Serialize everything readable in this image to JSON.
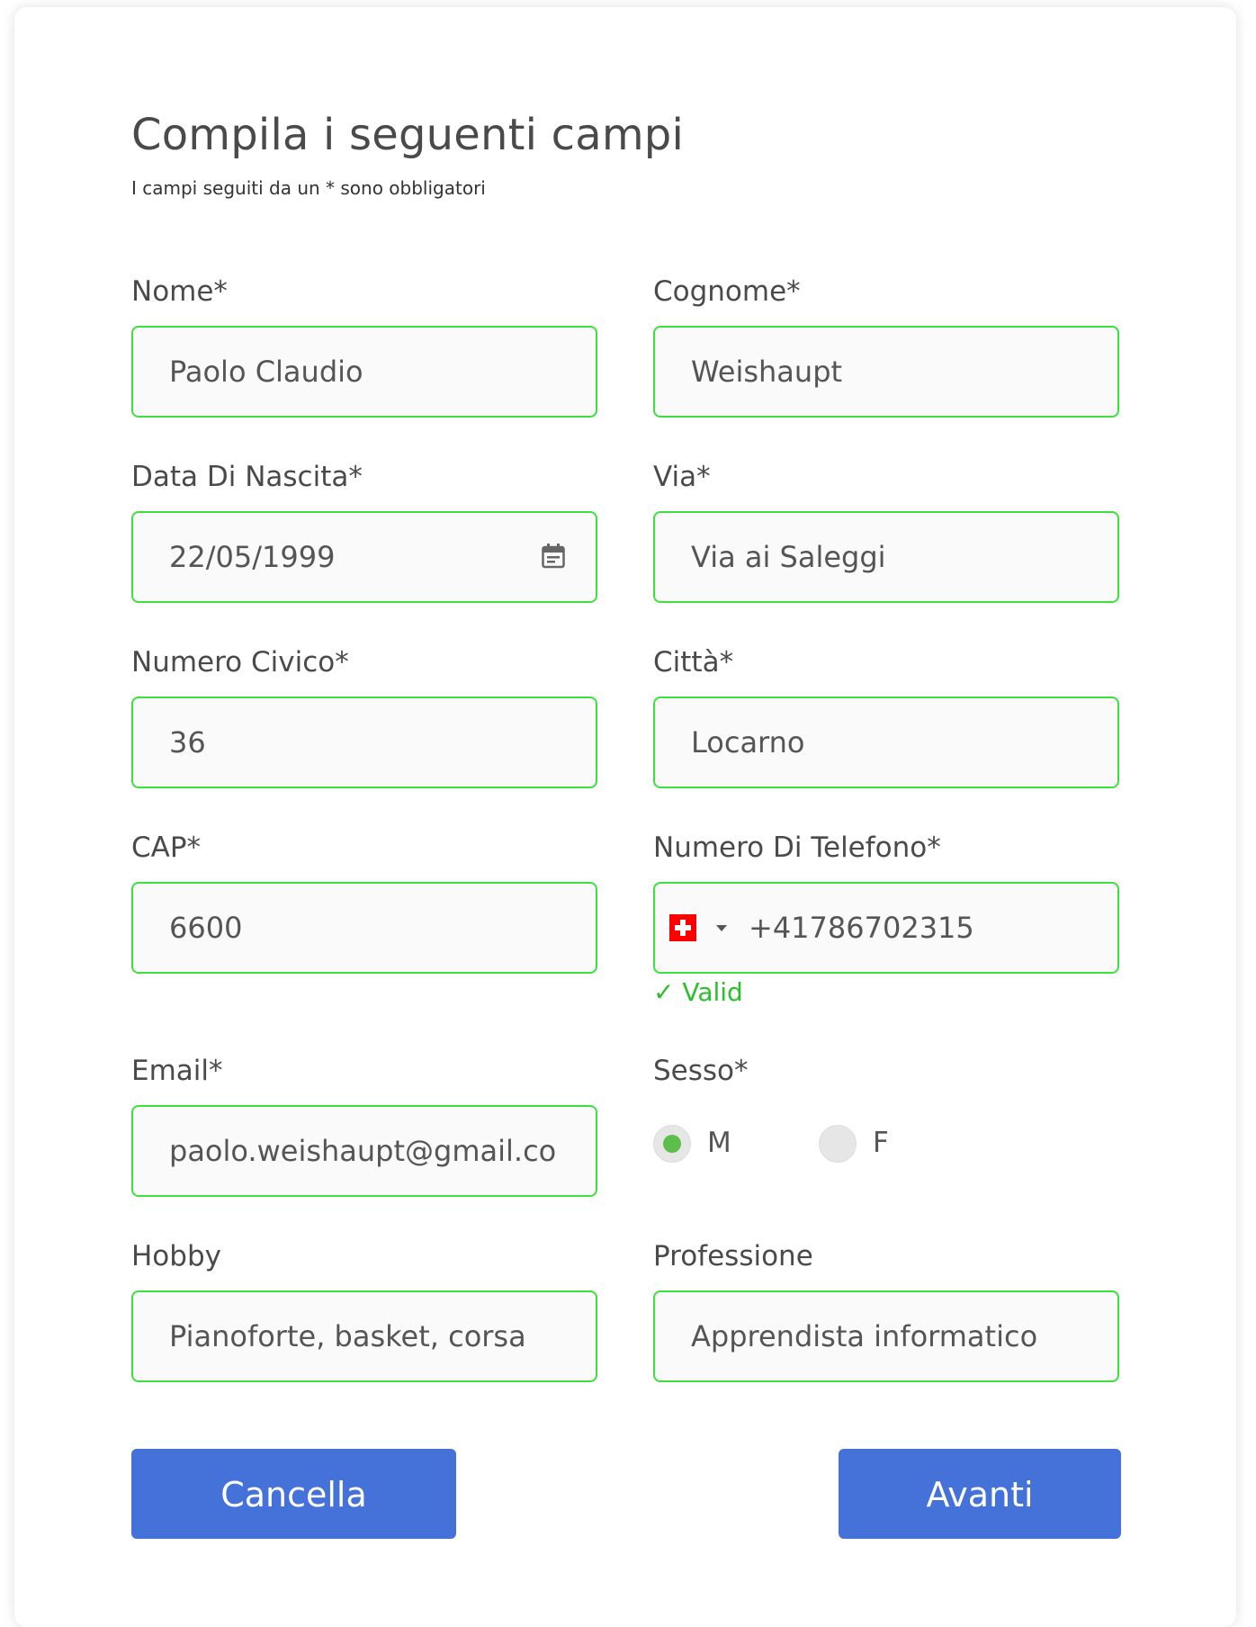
{
  "header": {
    "title": "Compila i seguenti campi",
    "subtitle": "I campi seguiti da un * sono obbligatori"
  },
  "fields": {
    "nome": {
      "label": "Nome*",
      "value": "Paolo Claudio"
    },
    "cognome": {
      "label": "Cognome*",
      "value": "Weishaupt"
    },
    "data_nascita": {
      "label": "Data Di Nascita*",
      "value": "22/05/1999"
    },
    "via": {
      "label": "Via*",
      "value": "Via ai Saleggi"
    },
    "numero_civico": {
      "label": "Numero Civico*",
      "value": "36"
    },
    "citta": {
      "label": "Città*",
      "value": "Locarno"
    },
    "cap": {
      "label": "CAP*",
      "value": "6600"
    },
    "telefono": {
      "label": "Numero Di Telefono*",
      "value": "+41786702315",
      "country_flag": "switzerland-flag-icon",
      "status": "✓ Valid"
    },
    "email": {
      "label": "Email*",
      "value": "paolo.weishaupt@gmail.co"
    },
    "sesso": {
      "label": "Sesso*",
      "options": [
        "M",
        "F"
      ],
      "selected": "M"
    },
    "hobby": {
      "label": "Hobby",
      "value": "Pianoforte, basket, corsa"
    },
    "professione": {
      "label": "Professione",
      "value": "Apprendista informatico"
    }
  },
  "buttons": {
    "cancel": "Cancella",
    "next": "Avanti"
  },
  "colors": {
    "valid_border": "#3ee03e",
    "valid_text": "#2cbf2c",
    "primary_button": "#4472d8",
    "radio_checked": "#5bbf49"
  }
}
